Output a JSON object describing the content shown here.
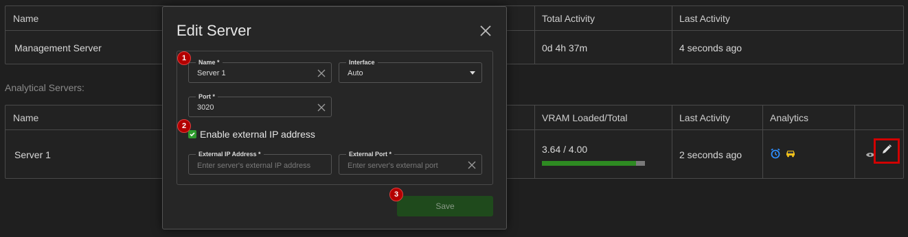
{
  "management_table": {
    "headers": [
      "Name",
      "Total Activity",
      "Last Activity"
    ],
    "row": {
      "name": "Management Server",
      "total_activity": "0d 4h 37m",
      "last_activity": "4 seconds ago"
    }
  },
  "section_label": "Analytical Servers:",
  "analytical_table": {
    "headers": [
      "Name",
      "VRAM Loaded/Total",
      "Last Activity",
      "Analytics"
    ],
    "row": {
      "name": "Server 1",
      "vram_text": "3.64 / 4.00",
      "vram_fraction": 0.91,
      "last_activity": "2 seconds ago",
      "analytics_icons": [
        "alarm-clock-icon",
        "car-icon"
      ]
    }
  },
  "dialog": {
    "title": "Edit Server",
    "name_field": {
      "label": "Name *",
      "value": "Server 1"
    },
    "interface_field": {
      "label": "Interface",
      "value": "Auto"
    },
    "port_field": {
      "label": "Port *",
      "value": "3020"
    },
    "external_ip_checkbox": {
      "label": "Enable external IP address",
      "checked": true
    },
    "external_ip_field": {
      "label": "External IP Address *",
      "placeholder": "Enter server's external IP address"
    },
    "external_port_field": {
      "label": "External Port *",
      "placeholder": "Enter server's external port"
    },
    "save_label": "Save"
  },
  "markers": [
    "1",
    "2",
    "3"
  ],
  "colors": {
    "accent_green": "#2e9b2e",
    "marker_red": "#b30000",
    "highlight_red": "#d10000"
  }
}
